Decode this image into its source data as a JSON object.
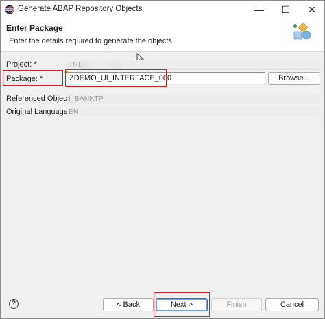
{
  "window": {
    "title": "Generate ABAP Repository Objects",
    "minimize_glyph": "—",
    "maximize_glyph": "☐",
    "close_glyph": "✕"
  },
  "header": {
    "title": "Enter Package",
    "description": "Enter the details required to generate the objects"
  },
  "form": {
    "project": {
      "label": "Project: *",
      "value": "TRL"
    },
    "package": {
      "label": "Package: *",
      "value": "ZDEMO_UI_INTERFACE_000",
      "browse_label": "Browse..."
    },
    "referenced_object": {
      "label": "Referenced Object: *",
      "value": "I_BANKTP"
    },
    "original_language": {
      "label": "Original Language:",
      "value": "EN"
    }
  },
  "footer": {
    "help_glyph": "?",
    "back_label": "< Back",
    "next_label": "Next >",
    "finish_label": "Finish",
    "cancel_label": "Cancel"
  },
  "colors": {
    "highlight": "#d2232a",
    "default_button_border": "#2f6fd0",
    "disabled_text": "#a0a0a0"
  }
}
